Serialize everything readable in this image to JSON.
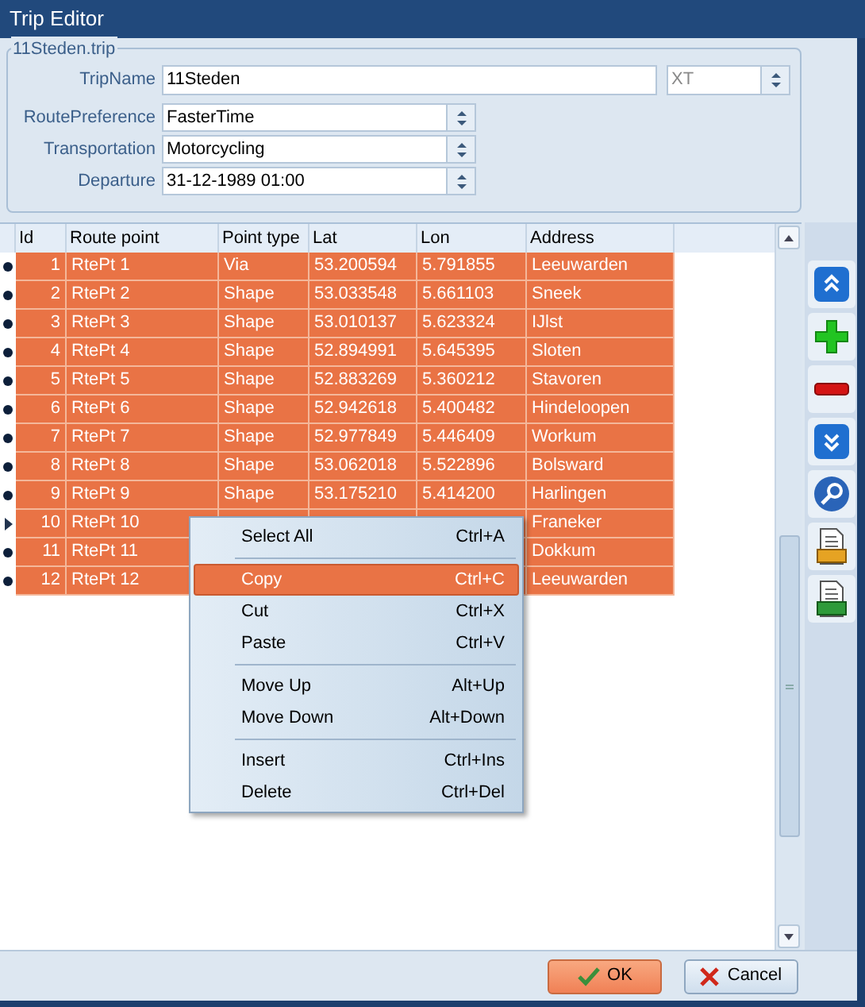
{
  "window": {
    "title": "Trip Editor"
  },
  "group": {
    "title": "11Steden.trip",
    "trip_name": {
      "label": "TripName",
      "value": "11Steden"
    },
    "model": {
      "value": "XT",
      "disabled": true
    },
    "fields": [
      {
        "label": "RoutePreference",
        "value": "FasterTime"
      },
      {
        "label": "Transportation",
        "value": "Motorcycling"
      },
      {
        "label": "Departure",
        "value": "31-12-1989 01:00"
      }
    ]
  },
  "table": {
    "columns": [
      "Id",
      "Route point",
      "Point type",
      "Lat",
      "Lon",
      "Address"
    ],
    "rows": [
      {
        "id": "1",
        "route_point": "RtePt 1",
        "point_type": "Via",
        "lat": "53.200594",
        "lon": "5.791855",
        "address": "Leeuwarden",
        "selected": true,
        "current": false
      },
      {
        "id": "2",
        "route_point": "RtePt 2",
        "point_type": "Shape",
        "lat": "53.033548",
        "lon": "5.661103",
        "address": "Sneek",
        "selected": true,
        "current": false
      },
      {
        "id": "3",
        "route_point": "RtePt 3",
        "point_type": "Shape",
        "lat": "53.010137",
        "lon": "5.623324",
        "address": "IJlst",
        "selected": true,
        "current": false
      },
      {
        "id": "4",
        "route_point": "RtePt 4",
        "point_type": "Shape",
        "lat": "52.894991",
        "lon": "5.645395",
        "address": "Sloten",
        "selected": true,
        "current": false
      },
      {
        "id": "5",
        "route_point": "RtePt 5",
        "point_type": "Shape",
        "lat": "52.883269",
        "lon": "5.360212",
        "address": "Stavoren",
        "selected": true,
        "current": false
      },
      {
        "id": "6",
        "route_point": "RtePt 6",
        "point_type": "Shape",
        "lat": "52.942618",
        "lon": "5.400482",
        "address": "Hindeloopen",
        "selected": true,
        "current": false
      },
      {
        "id": "7",
        "route_point": "RtePt 7",
        "point_type": "Shape",
        "lat": "52.977849",
        "lon": "5.446409",
        "address": "Workum",
        "selected": true,
        "current": false
      },
      {
        "id": "8",
        "route_point": "RtePt 8",
        "point_type": "Shape",
        "lat": "53.062018",
        "lon": "5.522896",
        "address": "Bolsward",
        "selected": true,
        "current": false
      },
      {
        "id": "9",
        "route_point": "RtePt 9",
        "point_type": "Shape",
        "lat": "53.175210",
        "lon": "5.414200",
        "address": "Harlingen",
        "selected": true,
        "current": false
      },
      {
        "id": "10",
        "route_point": "RtePt 10",
        "address": "Franeker",
        "selected": true,
        "current": true
      },
      {
        "id": "11",
        "route_point": "RtePt 11",
        "address": "Dokkum",
        "selected": true,
        "current": false
      },
      {
        "id": "12",
        "route_point": "RtePt 12",
        "address": "Leeuwarden",
        "selected": true,
        "current": false
      }
    ]
  },
  "context_menu": {
    "items": [
      {
        "label": "Select All",
        "shortcut": "Ctrl+A",
        "selected": false,
        "separator_before": false
      },
      {
        "label": "Copy",
        "shortcut": "Ctrl+C",
        "selected": true,
        "separator_before": true
      },
      {
        "label": "Cut",
        "shortcut": "Ctrl+X",
        "selected": false,
        "separator_before": false
      },
      {
        "label": "Paste",
        "shortcut": "Ctrl+V",
        "selected": false,
        "separator_before": false
      },
      {
        "label": "Move Up",
        "shortcut": "Alt+Up",
        "selected": false,
        "separator_before": true
      },
      {
        "label": "Move Down",
        "shortcut": "Alt+Down",
        "selected": false,
        "separator_before": false
      },
      {
        "label": "Insert",
        "shortcut": "Ctrl+Ins",
        "selected": false,
        "separator_before": true
      },
      {
        "label": "Delete",
        "shortcut": "Ctrl+Del",
        "selected": false,
        "separator_before": false
      }
    ]
  },
  "toolbar": [
    {
      "kind": "up"
    },
    {
      "kind": "add"
    },
    {
      "kind": "remove"
    },
    {
      "kind": "down"
    },
    {
      "kind": "search"
    },
    {
      "kind": "gpx"
    },
    {
      "kind": "csv"
    }
  ],
  "buttons": [
    {
      "kind": "ok",
      "label": "OK"
    },
    {
      "kind": "cancel",
      "label": "Cancel"
    }
  ]
}
